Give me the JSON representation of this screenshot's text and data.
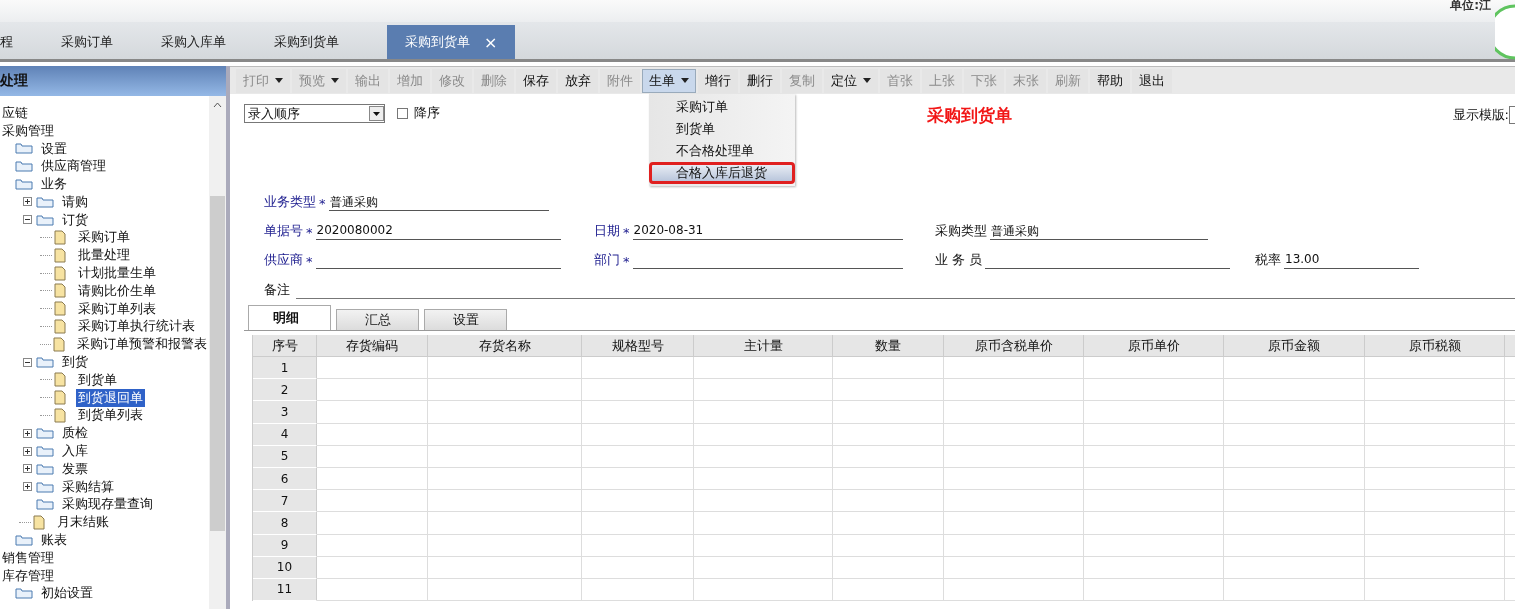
{
  "header": {
    "unit": "单位:江"
  },
  "tabs": [
    {
      "label": "程",
      "selected": false,
      "closable": false
    },
    {
      "label": "采购订单",
      "selected": false,
      "closable": false
    },
    {
      "label": "采购入库单",
      "selected": false,
      "closable": false
    },
    {
      "label": "采购到货单",
      "selected": false,
      "closable": false
    },
    {
      "label": "采购到货单",
      "selected": true,
      "closable": true,
      "close": "×"
    }
  ],
  "sidebar": {
    "title": "处理",
    "tree": [
      {
        "label": "应链",
        "children": [
          {
            "label": "采购管理",
            "children": [
              {
                "label": "设置",
                "kind": "folder"
              },
              {
                "label": "供应商管理",
                "kind": "folder"
              },
              {
                "label": "业务",
                "kind": "folder",
                "children": [
                  {
                    "label": "请购",
                    "kind": "folder",
                    "expanded": false
                  },
                  {
                    "label": "订货",
                    "kind": "folder",
                    "expanded": true,
                    "children": [
                      {
                        "label": "采购订单",
                        "kind": "doc",
                        "selected": false
                      },
                      {
                        "label": "批量处理",
                        "kind": "doc",
                        "selected": false
                      },
                      {
                        "label": "计划批量生单",
                        "kind": "doc",
                        "selected": false
                      },
                      {
                        "label": "请购比价生单",
                        "kind": "doc",
                        "selected": false
                      },
                      {
                        "label": "采购订单列表",
                        "kind": "doc",
                        "selected": false
                      },
                      {
                        "label": "采购订单执行统计表",
                        "kind": "doc",
                        "selected": false
                      },
                      {
                        "label": "采购订单预警和报警表",
                        "kind": "doc",
                        "selected": false
                      }
                    ]
                  },
                  {
                    "label": "到货",
                    "kind": "folder",
                    "expanded": true,
                    "children": [
                      {
                        "label": "到货单",
                        "kind": "doc",
                        "selected": false
                      },
                      {
                        "label": "到货退回单",
                        "kind": "doc",
                        "selected": true
                      },
                      {
                        "label": "到货单列表",
                        "kind": "doc",
                        "selected": false
                      }
                    ]
                  },
                  {
                    "label": "质检",
                    "kind": "folder",
                    "expanded": false
                  },
                  {
                    "label": "入库",
                    "kind": "folder",
                    "expanded": false
                  },
                  {
                    "label": "发票",
                    "kind": "folder",
                    "expanded": false
                  },
                  {
                    "label": "采购结算",
                    "kind": "folder",
                    "expanded": false
                  },
                  {
                    "label": "采购现存量查询",
                    "kind": "folder"
                  },
                  {
                    "label": "月末结账",
                    "kind": "doc",
                    "selected": false
                  }
                ]
              },
              {
                "label": "账表",
                "kind": "folder"
              }
            ]
          },
          {
            "label": "销售管理"
          },
          {
            "label": "库存管理",
            "children": [
              {
                "label": "初始设置",
                "kind": "folder"
              }
            ]
          }
        ]
      }
    ]
  },
  "toolbar": [
    {
      "label": "打印",
      "disabled": true,
      "dropdown": true,
      "open": false
    },
    {
      "label": "预览",
      "disabled": true,
      "dropdown": true,
      "open": false
    },
    {
      "label": "输出",
      "disabled": true,
      "dropdown": false,
      "open": false
    },
    {
      "label": "增加",
      "disabled": true,
      "dropdown": false,
      "open": false
    },
    {
      "label": "修改",
      "disabled": true,
      "dropdown": false,
      "open": false
    },
    {
      "label": "删除",
      "disabled": true,
      "dropdown": false,
      "open": false
    },
    {
      "label": "保存",
      "disabled": false,
      "dropdown": false,
      "open": false
    },
    {
      "label": "放弃",
      "disabled": false,
      "dropdown": false,
      "open": false
    },
    {
      "label": "附件",
      "disabled": true,
      "dropdown": false,
      "open": false
    },
    {
      "label": "生单",
      "disabled": false,
      "dropdown": true,
      "open": true
    },
    {
      "label": "增行",
      "disabled": false,
      "dropdown": false,
      "open": false
    },
    {
      "label": "删行",
      "disabled": false,
      "dropdown": false,
      "open": false
    },
    {
      "label": "复制",
      "disabled": true,
      "dropdown": false,
      "open": false
    },
    {
      "label": "定位",
      "disabled": false,
      "dropdown": true,
      "open": false
    },
    {
      "label": "首张",
      "disabled": true,
      "dropdown": false,
      "open": false
    },
    {
      "label": "上张",
      "disabled": true,
      "dropdown": false,
      "open": false
    },
    {
      "label": "下张",
      "disabled": true,
      "dropdown": false,
      "open": false
    },
    {
      "label": "末张",
      "disabled": true,
      "dropdown": false,
      "open": false
    },
    {
      "label": "刷新",
      "disabled": true,
      "dropdown": false,
      "open": false
    },
    {
      "label": "帮助",
      "disabled": false,
      "dropdown": false,
      "open": false
    },
    {
      "label": "退出",
      "disabled": false,
      "dropdown": false,
      "open": false
    }
  ],
  "menu": [
    {
      "label": "采购订单",
      "selected": false
    },
    {
      "label": "到货单",
      "selected": false
    },
    {
      "label": "不合格处理单",
      "selected": false
    },
    {
      "label": "合格入库后退货",
      "selected": true
    }
  ],
  "sort": {
    "value": "录入顺序",
    "descending_label": "降序",
    "descending": false
  },
  "form": {
    "title": "采购到货单",
    "template_label": "显示模版:",
    "fields": [
      [
        {
          "label": "业务类型",
          "required": true,
          "mark": "*",
          "value": "普通采购"
        }
      ],
      [
        {
          "label": "单据号",
          "required": true,
          "mark": "*",
          "value": "2020080002"
        },
        {
          "label": "日期",
          "required": true,
          "mark": "*",
          "value": "2020-08-31"
        },
        {
          "label": "采购类型",
          "required": false,
          "value": "普通采购"
        }
      ],
      [
        {
          "label": "供应商",
          "required": true,
          "mark": "*"
        },
        {
          "label": "部门",
          "required": true,
          "mark": "*"
        },
        {
          "label": "业 务 员",
          "required": false
        },
        {
          "label": "税率",
          "required": false,
          "value": "13.00"
        }
      ]
    ],
    "note_label": "备注"
  },
  "detail_tabs": [
    {
      "label": "明细",
      "selected": true
    },
    {
      "label": "汇总",
      "selected": false
    },
    {
      "label": "设置",
      "selected": false
    }
  ],
  "table": {
    "columns": [
      "序号",
      "存货编码",
      "存货名称",
      "规格型号",
      "主计量",
      "数量",
      "原币含税单价",
      "原币单价",
      "原币金额",
      "原币税额"
    ],
    "rows": [
      "1",
      "2",
      "3",
      "4",
      "5",
      "6",
      "7",
      "8",
      "9",
      "10",
      "11"
    ]
  }
}
